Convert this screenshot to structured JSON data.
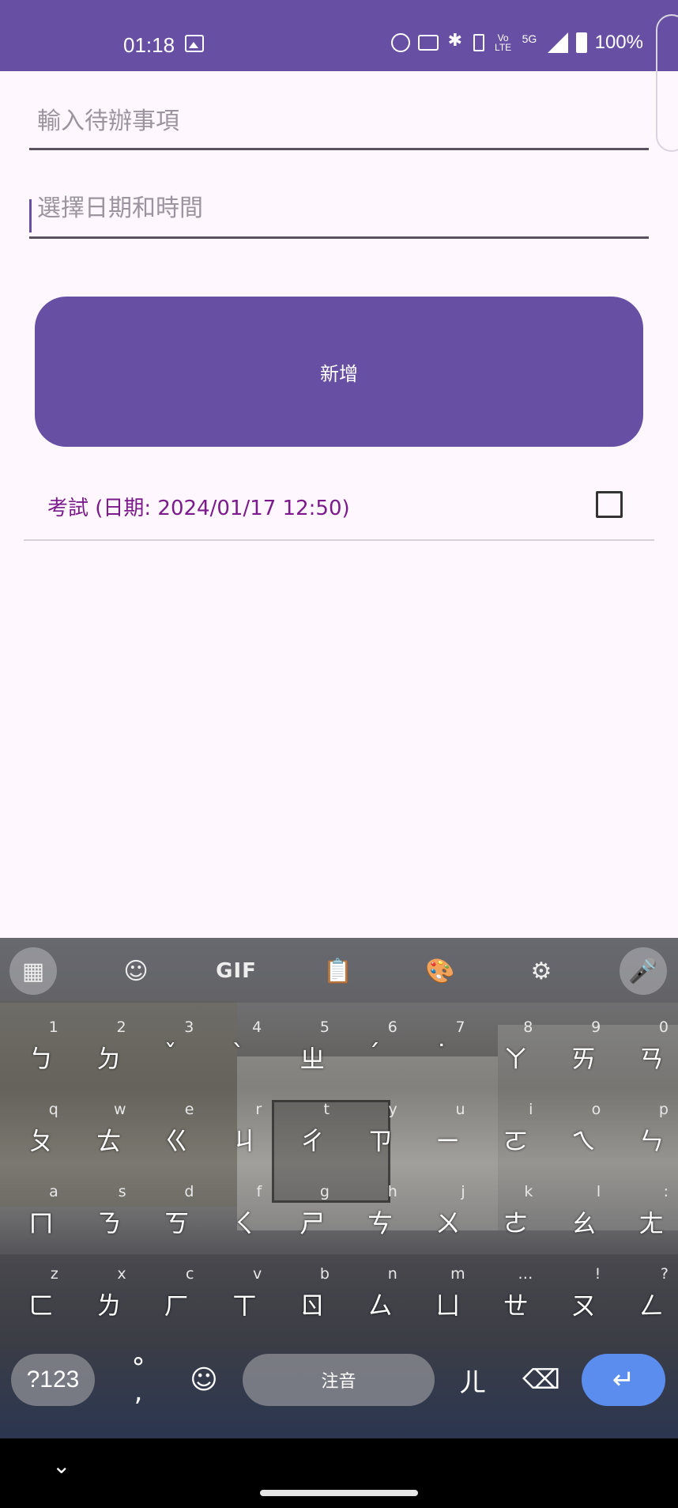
{
  "status_bar": {
    "time": "01:18",
    "five_g": "5G",
    "volte": "Vo LTE",
    "battery": "100%"
  },
  "form": {
    "todo_placeholder": "輸入待辦事項",
    "date_placeholder": "選擇日期和時間",
    "add_button_label": "新增"
  },
  "list": {
    "items": [
      {
        "label": "考試 (日期: 2024/01/17 12:50)",
        "checked": false
      }
    ]
  },
  "keyboard": {
    "toolbar": {
      "gif_label": "GIF"
    },
    "rows": [
      {
        "keys": [
          {
            "hint": "1",
            "main": "ㄅ"
          },
          {
            "hint": "2",
            "main": "ㄉ"
          },
          {
            "hint": "3",
            "main": "ˇ"
          },
          {
            "hint": "4",
            "main": "ˋ"
          },
          {
            "hint": "5",
            "main": "ㄓ"
          },
          {
            "hint": "6",
            "main": "ˊ"
          },
          {
            "hint": "7",
            "main": "˙"
          },
          {
            "hint": "8",
            "main": "ㄚ"
          },
          {
            "hint": "9",
            "main": "ㄞ"
          },
          {
            "hint": "0",
            "main": "ㄢ"
          }
        ]
      },
      {
        "keys": [
          {
            "hint": "q",
            "main": "ㄆ"
          },
          {
            "hint": "w",
            "main": "ㄊ"
          },
          {
            "hint": "e",
            "main": "ㄍ"
          },
          {
            "hint": "r",
            "main": "ㄐ"
          },
          {
            "hint": "t",
            "main": "ㄔ"
          },
          {
            "hint": "y",
            "main": "ㄗ"
          },
          {
            "hint": "u",
            "main": "ㄧ"
          },
          {
            "hint": "i",
            "main": "ㄛ"
          },
          {
            "hint": "o",
            "main": "ㄟ"
          },
          {
            "hint": "p",
            "main": "ㄣ"
          }
        ]
      },
      {
        "keys": [
          {
            "hint": "a",
            "main": "ㄇ"
          },
          {
            "hint": "s",
            "main": "ㄋ"
          },
          {
            "hint": "d",
            "main": "ㄎ"
          },
          {
            "hint": "f",
            "main": "ㄑ"
          },
          {
            "hint": "g",
            "main": "ㄕ"
          },
          {
            "hint": "h",
            "main": "ㄘ"
          },
          {
            "hint": "j",
            "main": "ㄨ"
          },
          {
            "hint": "k",
            "main": "ㄜ"
          },
          {
            "hint": "l",
            "main": "ㄠ"
          },
          {
            "hint": ":",
            "main": "ㄤ"
          }
        ]
      },
      {
        "keys": [
          {
            "hint": "z",
            "main": "ㄈ"
          },
          {
            "hint": "x",
            "main": "ㄌ"
          },
          {
            "hint": "c",
            "main": "ㄏ"
          },
          {
            "hint": "v",
            "main": "ㄒ"
          },
          {
            "hint": "b",
            "main": "ㄖ"
          },
          {
            "hint": "n",
            "main": "ㄙ"
          },
          {
            "hint": "m",
            "main": "ㄩ"
          },
          {
            "hint": "…",
            "main": "ㄝ"
          },
          {
            "hint": "!",
            "main": "ㄡ"
          },
          {
            "hint": "?",
            "main": "ㄥ"
          }
        ]
      }
    ],
    "bottom": {
      "symbols_label": "?123",
      "punct_top": "°",
      "punct_bottom": ",",
      "space_label": "注音",
      "er_label": "ㄦ"
    }
  },
  "colors": {
    "primary": "#6750a4",
    "list_text": "#7b1a8a",
    "enter_key": "#5b8def"
  }
}
